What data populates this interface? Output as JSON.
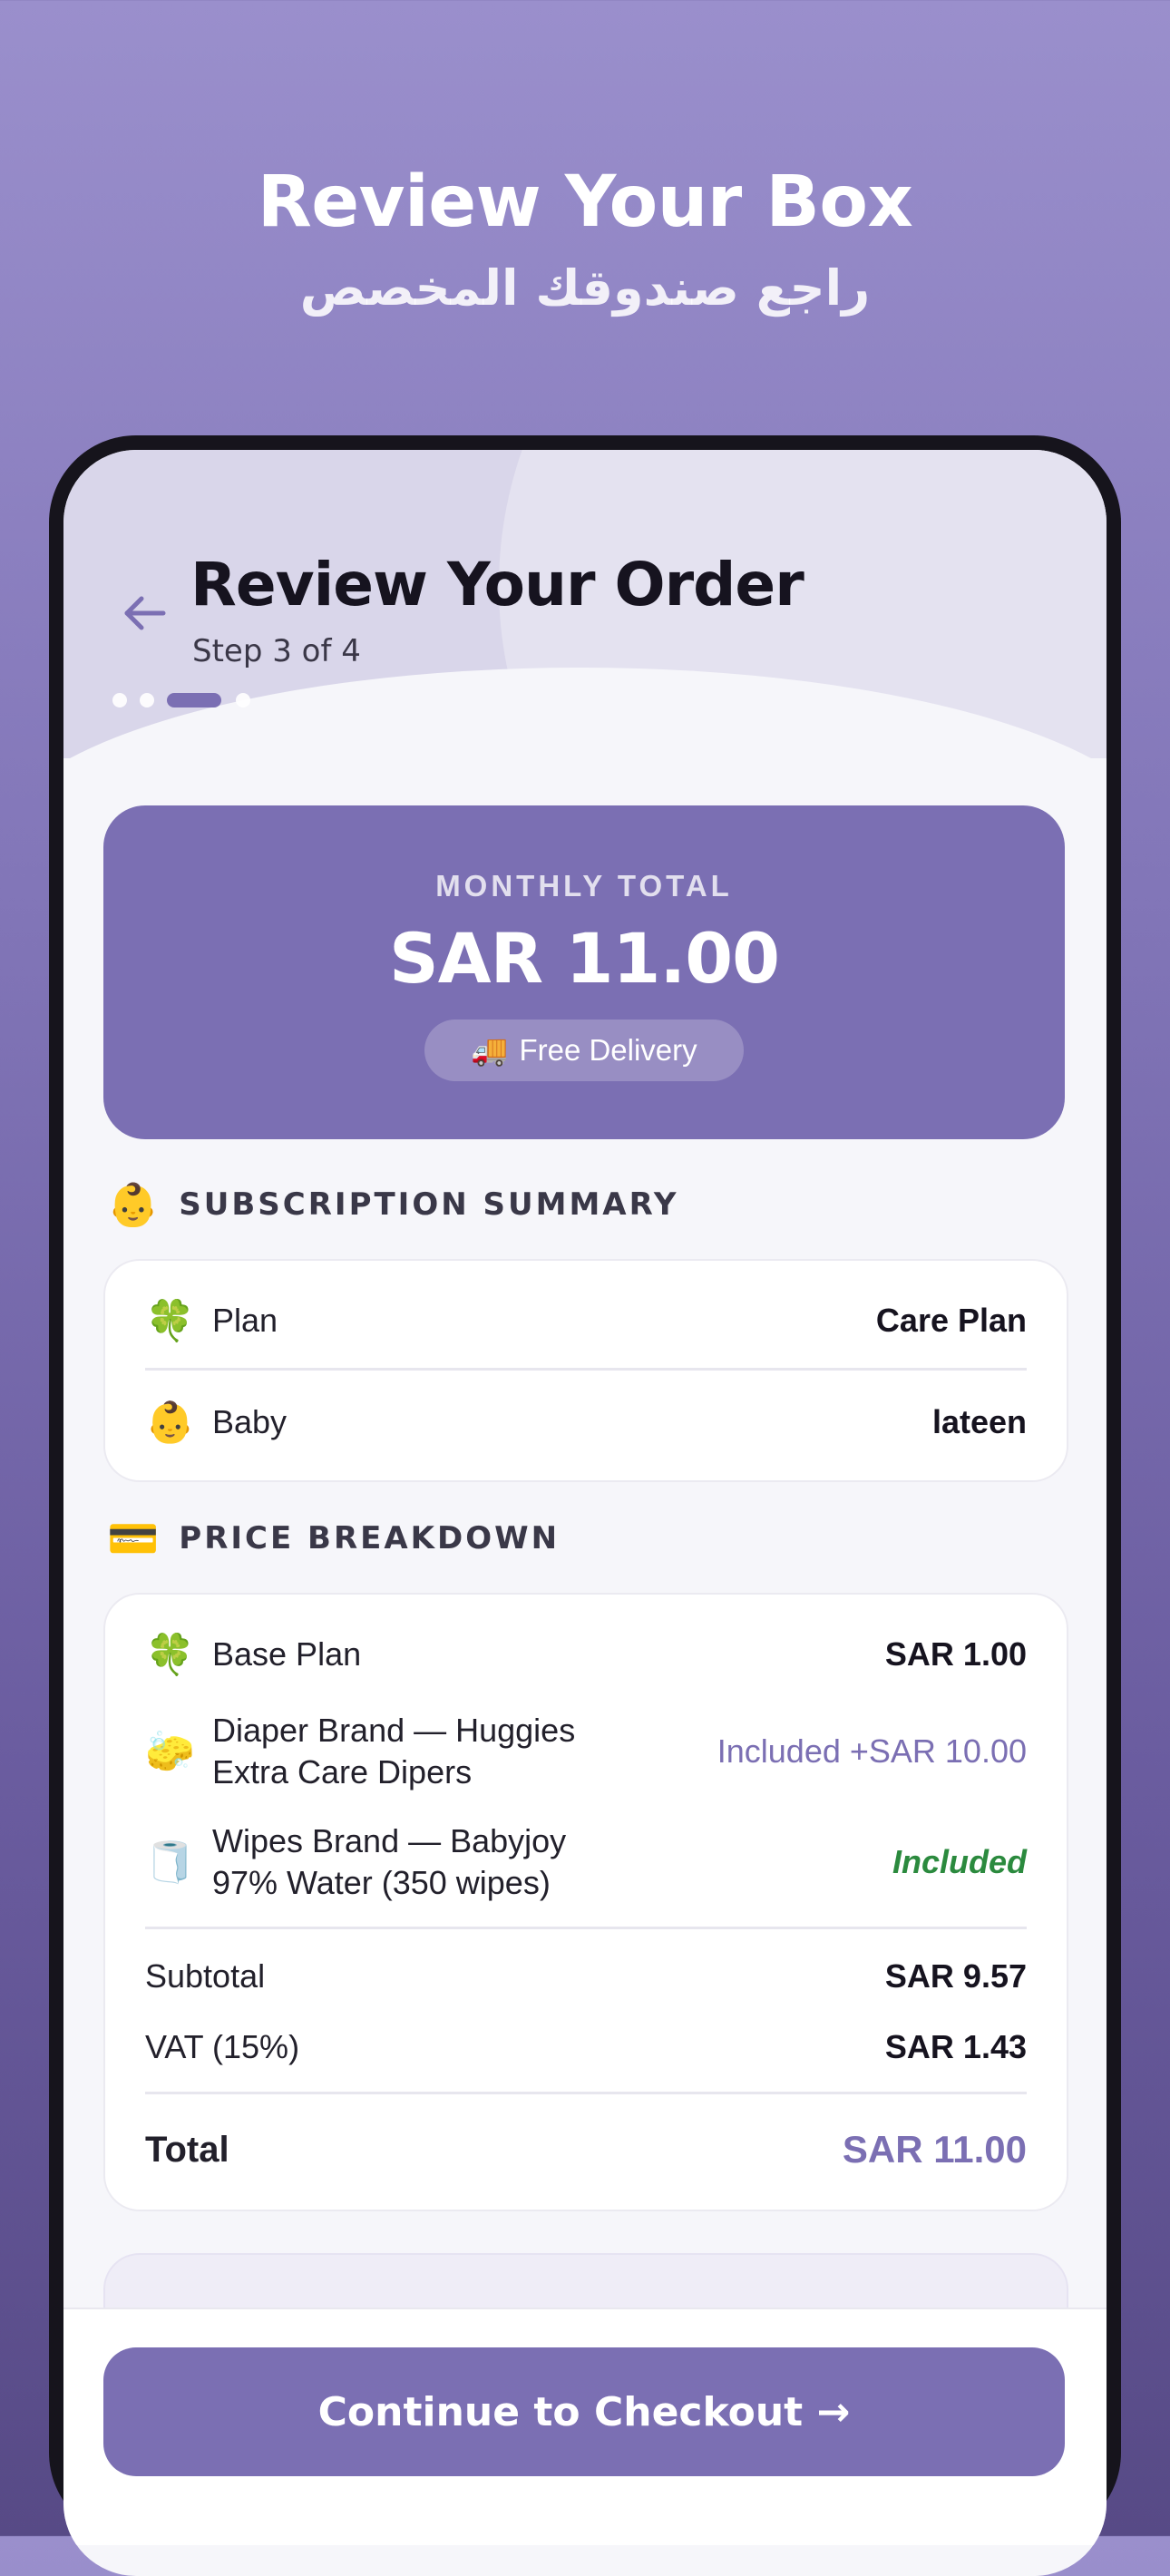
{
  "hero": {
    "title": "Review Your Box",
    "subtitle_ar": "راجع صندوقك المخصص"
  },
  "header": {
    "title": "Review Your Order",
    "step": "Step 3 of 4",
    "current_step": 3,
    "total_steps": 4
  },
  "monthly": {
    "label": "MONTHLY TOTAL",
    "amount": "SAR 11.00",
    "delivery_icon": "🚚",
    "delivery": "Free Delivery"
  },
  "subscription": {
    "icon": "👶",
    "heading": "SUBSCRIPTION SUMMARY",
    "rows": [
      {
        "icon": "🍀",
        "label": "Plan",
        "value": "Care Plan"
      },
      {
        "icon": "👶",
        "label": "Baby",
        "value": "lateen"
      }
    ]
  },
  "price": {
    "icon": "💳",
    "heading": "PRICE BREAKDOWN",
    "items": [
      {
        "icon": "🍀",
        "label": "Base Plan",
        "value": "SAR 1.00"
      },
      {
        "icon": "🧽",
        "label": "Diaper Brand — Huggies Extra Care Dipers",
        "value": "Included +SAR 10.00"
      },
      {
        "icon": "🧻",
        "label": "Wipes Brand — Babyjoy 97% Water (350 wipes)",
        "value": "Included"
      }
    ],
    "subtotal_label": "Subtotal",
    "subtotal": "SAR 9.57",
    "vat_label": "VAT (15%)",
    "vat": "SAR 1.43",
    "total_label": "Total",
    "total": "SAR 11.00"
  },
  "cta": {
    "label": "Continue to Checkout →"
  },
  "colors": {
    "accent": "#7b6fb3",
    "included_green": "#2b8a3e"
  }
}
